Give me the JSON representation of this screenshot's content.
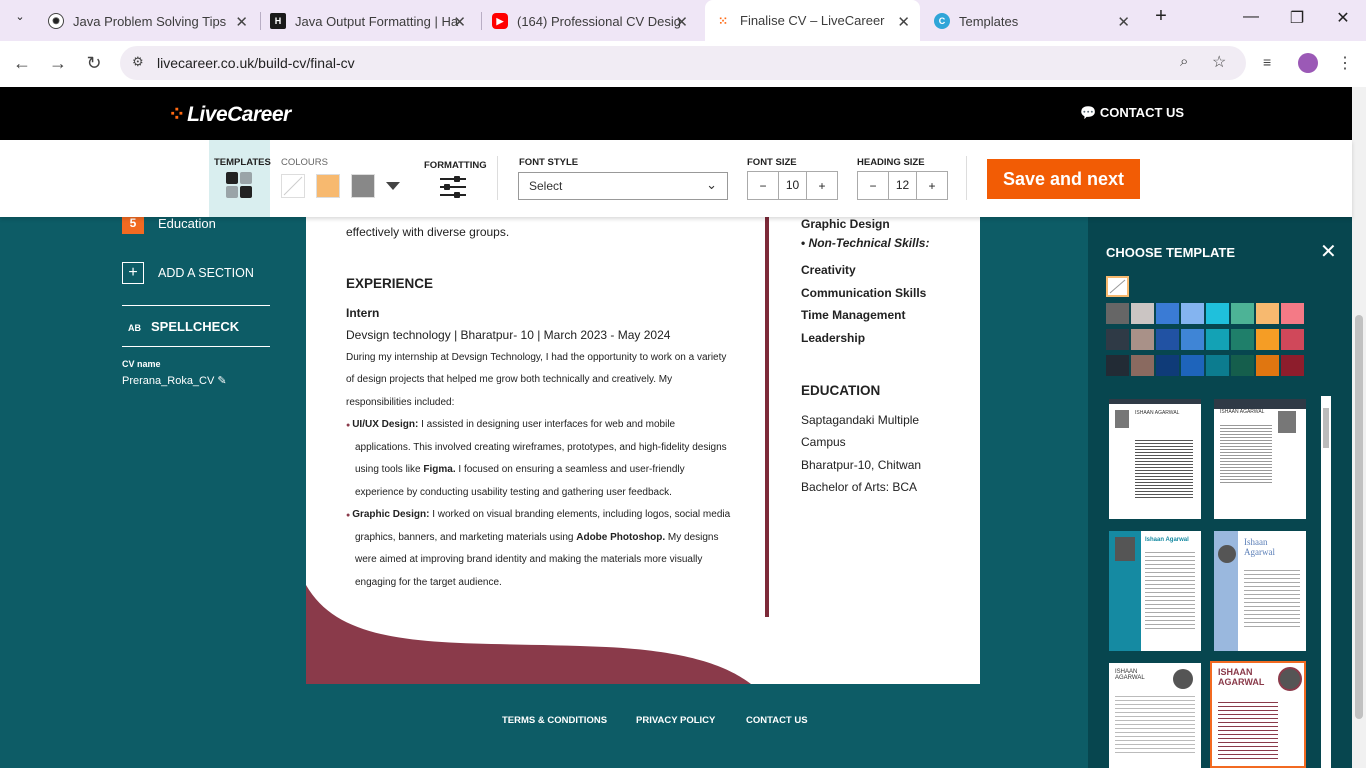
{
  "browser": {
    "tabs": [
      {
        "title": "Java Problem Solving Tips",
        "icon": "chatgpt-icon"
      },
      {
        "title": "Java Output Formatting | Ha",
        "icon": "hackerrank-icon"
      },
      {
        "title": "(164) Professional CV Desig",
        "icon": "youtube-icon"
      },
      {
        "title": "Finalise CV – LiveCareer",
        "icon": "livecareer-icon"
      },
      {
        "title": "Templates",
        "icon": "canva-icon"
      }
    ],
    "url": "livecareer.co.uk/build-cv/final-cv"
  },
  "site": {
    "logo": "LiveCareer",
    "contact": "CONTACT US"
  },
  "toolbar": {
    "templates": "TEMPLATES",
    "colours": "COLOURS",
    "formatting": "FORMATTING",
    "font_style": "FONT STYLE",
    "font_style_value": "Select",
    "font_size": "FONT SIZE",
    "font_size_value": "10",
    "heading_size": "HEADING SIZE",
    "heading_size_value": "12",
    "save": "Save and next"
  },
  "sidebar": {
    "step_num": "5",
    "step_label": "Education",
    "add_section": "ADD A SECTION",
    "spellcheck": "SPELLCHECK",
    "spell_icon": "AB",
    "cv_name_label": "CV name",
    "cv_name": "Prerana_Roka_CV"
  },
  "cv": {
    "line_top": "effectively with diverse groups.",
    "exp_heading": "EXPERIENCE",
    "job_title": "Intern",
    "job_meta": "Devsign technology | Bharatpur- 10 | March 2023 - May 2024",
    "desc": [
      "During my internship at Devsign Technology, I had the opportunity to work on a variety",
      "of design projects that helped me grow both technically and creatively. My",
      "responsibilities included:"
    ],
    "b1_bold": "UI/UX Design:",
    "b1": [
      " I assisted in designing user interfaces for web and mobile",
      "applications. This involved creating wireframes, prototypes, and high-fidelity designs",
      "using tools like ",
      "Figma.",
      ". I focused on ensuring a seamless and user-friendly",
      "experience by conducting usability testing and gathering user feedback."
    ],
    "b2_bold": "Graphic Design:",
    "b2": [
      " I worked on visual branding elements, including logos, social media",
      "graphics, banners, and marketing materials using ",
      "Adobe Photoshop.",
      " My designs",
      "were aimed at improving brand identity and making the materials more visually",
      "engaging for the target audience."
    ],
    "right": {
      "graphic": "Graphic Design",
      "nontech": "Non-Technical Skills:",
      "skills": [
        "Creativity",
        "Communication Skills",
        "Time Management",
        "Leadership"
      ],
      "edu_heading": "EDUCATION",
      "edu": [
        "Saptagandaki Multiple",
        "Campus",
        "Bharatpur-10, Chitwan",
        "Bachelor of Arts: BCA"
      ]
    }
  },
  "footer": {
    "terms": "TERMS & CONDITIONS",
    "privacy": "PRIVACY POLICY",
    "contact": "CONTACT US"
  },
  "panel": {
    "title": "CHOOSE TEMPLATE",
    "colors": [
      [
        "#666666",
        "#cbc5c3",
        "#3a7bd5",
        "#84b4f0",
        "#1fc0dc",
        "#4db396",
        "#f7b96f",
        "#f47a86"
      ],
      [
        "#2f3a46",
        "#a99188",
        "#2152a3",
        "#3f85d6",
        "#13a2b5",
        "#1f7f6a",
        "#f59d25",
        "#d0485a"
      ],
      [
        "#222b35",
        "#8a6a60",
        "#0f3b78",
        "#1e64bb",
        "#0c7c8f",
        "#155e4c",
        "#e07610",
        "#8d1d2c"
      ]
    ],
    "thumb_names": [
      "ISHAAN AGARWAL",
      "ISHAAN AGARWAL",
      "Ishaan Agarwal",
      "Ishaan Agarwal",
      "ISHAAN AGARWAL",
      "ISHAAN AGARWAL"
    ]
  },
  "colors": {
    "accent": "#f25c05",
    "teal": "#0d5c66",
    "maroon": "#7d2a39"
  }
}
